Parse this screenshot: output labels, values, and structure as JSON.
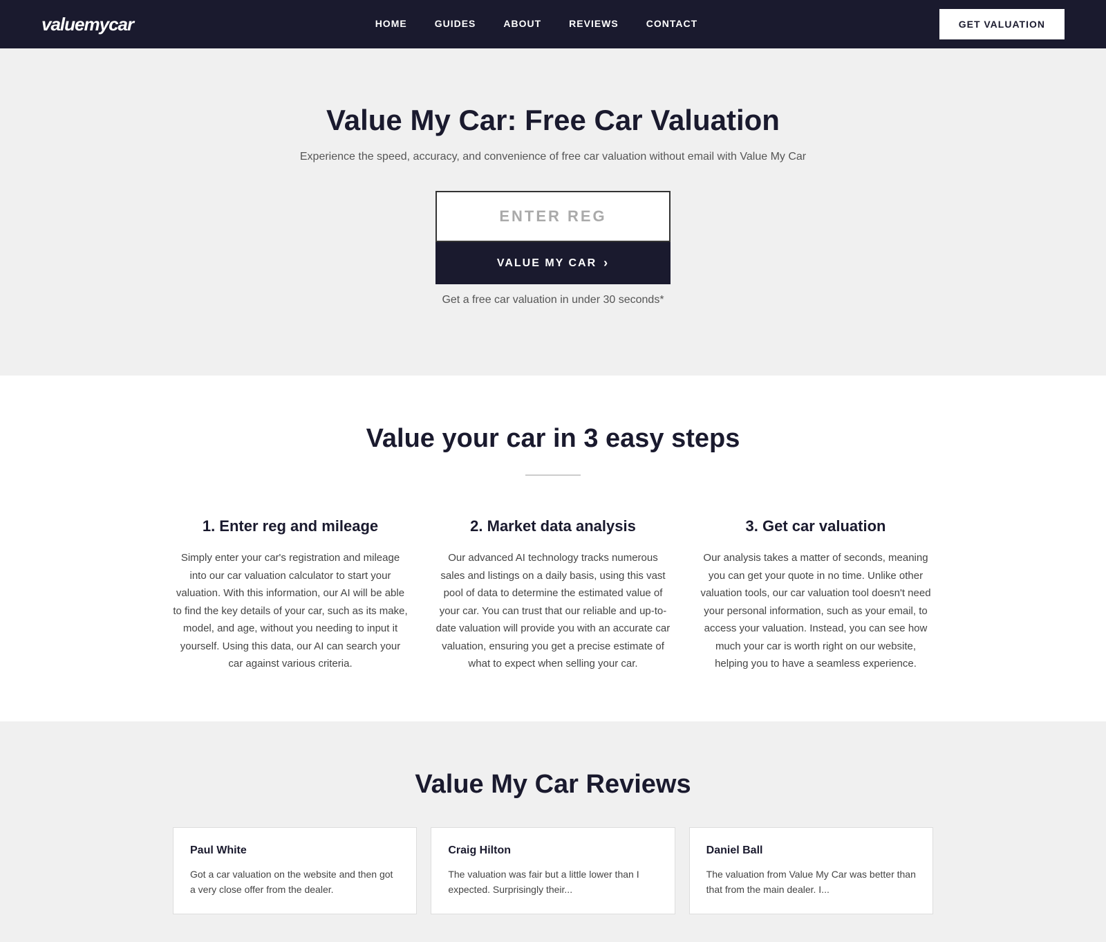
{
  "nav": {
    "logo": "valuemycar",
    "links": [
      {
        "label": "HOME",
        "id": "home"
      },
      {
        "label": "GUIDES",
        "id": "guides"
      },
      {
        "label": "ABOUT",
        "id": "about"
      },
      {
        "label": "REVIEWS",
        "id": "reviews"
      },
      {
        "label": "CONTACT",
        "id": "contact"
      }
    ],
    "cta": "GET VALUATION"
  },
  "hero": {
    "title": "Value My Car: Free Car Valuation",
    "subtitle": "Experience the speed, accuracy, and convenience of free car valuation without email with Value My Car",
    "input_placeholder": "ENTER REG",
    "button_label": "VALUE MY CAR",
    "note": "Get a free car valuation in under 30 seconds*"
  },
  "steps_section": {
    "title": "Value your car in 3 easy steps",
    "steps": [
      {
        "number": "1.",
        "title": "Enter reg and mileage",
        "description": "Simply enter your car's registration and mileage into our car valuation calculator to start your valuation. With this information, our AI will be able to find the key details of your car, such as its make, model, and age, without you needing to input it yourself. Using this data, our AI can search your car against various criteria."
      },
      {
        "number": "2.",
        "title": "Market data analysis",
        "description": "Our advanced AI technology tracks numerous sales and listings on a daily basis, using this vast pool of data to determine the estimated value of your car. You can trust that our reliable and up-to-date valuation will provide you with an accurate car valuation, ensuring you get a precise estimate of what to expect when selling your car."
      },
      {
        "number": "3.",
        "title": "Get car valuation",
        "description": "Our analysis takes a matter of seconds, meaning you can get your quote in no time. Unlike other valuation tools, our car valuation tool doesn't need your personal information, such as your email, to access your valuation. Instead, you can see how much your car is worth right on our website, helping you to have a seamless experience."
      }
    ]
  },
  "reviews_section": {
    "title": "Value My Car Reviews",
    "reviews": [
      {
        "name": "Paul White",
        "text": "Got a car valuation on the website and then got a very close offer from the dealer."
      },
      {
        "name": "Craig Hilton",
        "text": "The valuation was fair but a little lower than I expected. Surprisingly their..."
      },
      {
        "name": "Daniel Ball",
        "text": "The valuation from Value My Car was better than that from the main dealer. I..."
      }
    ]
  }
}
